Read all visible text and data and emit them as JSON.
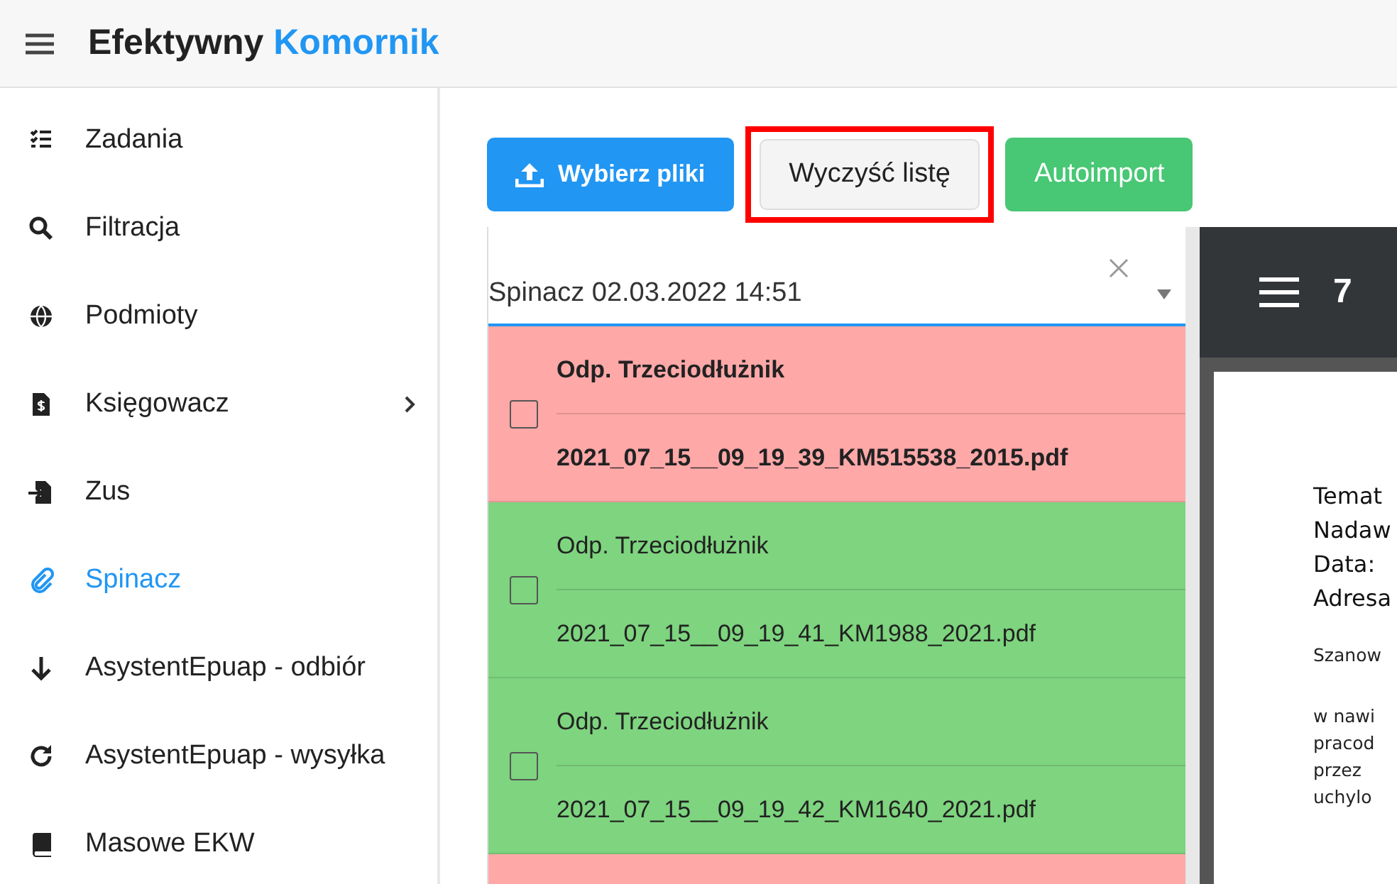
{
  "app_bar": {
    "title": "Efektywny",
    "title_accent": "Komornik"
  },
  "sidebar": {
    "items": [
      {
        "label": "Zadania",
        "selected": false,
        "expandable": false
      },
      {
        "label": "Filtracja",
        "selected": false,
        "expandable": false
      },
      {
        "label": "Podmioty",
        "selected": false,
        "expandable": false
      },
      {
        "label": "Księgowacz",
        "selected": false,
        "expandable": true
      },
      {
        "label": "Zus",
        "selected": false,
        "expandable": false
      },
      {
        "label": "Spinacz",
        "selected": true,
        "expandable": false
      },
      {
        "label": "AsystentEpuap - odbiór",
        "selected": false,
        "expandable": false
      },
      {
        "label": "AsystentEpuap - wysyłka",
        "selected": false,
        "expandable": false
      },
      {
        "label": "Masowe EKW",
        "selected": false,
        "expandable": false
      }
    ]
  },
  "toolbar": {
    "buttons": [
      {
        "kind": "upload",
        "label": "Wybierz pliki",
        "highlighted": false
      },
      {
        "kind": "plain",
        "label": "Wyczyść listę",
        "highlighted": true
      },
      {
        "kind": "success",
        "label": "Autoimport",
        "highlighted": false
      }
    ]
  },
  "select": {
    "value": "Spinacz 02.03.2022 14:51"
  },
  "files": [
    {
      "title": "Odp. Trzeciodłużnik",
      "filename": "2021_07_15__09_19_39_KM515538_2015.pdf",
      "color": "#ffa8a8",
      "unread": true,
      "checked": false
    },
    {
      "title": "Odp. Trzeciodłużnik",
      "filename": "2021_07_15__09_19_41_KM1988_2021.pdf",
      "color": "#7ed47f",
      "unread": false,
      "checked": false
    },
    {
      "title": "Odp. Trzeciodłużnik",
      "filename": "2021_07_15__09_19_42_KM1640_2021.pdf",
      "color": "#7ed47f",
      "unread": false,
      "checked": false
    },
    {
      "color": "#ffa8a8"
    }
  ],
  "viewer": {
    "page_number": "7",
    "header_lines": [
      "Temat",
      "Nadaw",
      "Data:",
      "Adresa"
    ],
    "greeting": "Szanow",
    "body_lines": [
      "w nawi",
      "pracod",
      "przez",
      "uchylo"
    ]
  }
}
